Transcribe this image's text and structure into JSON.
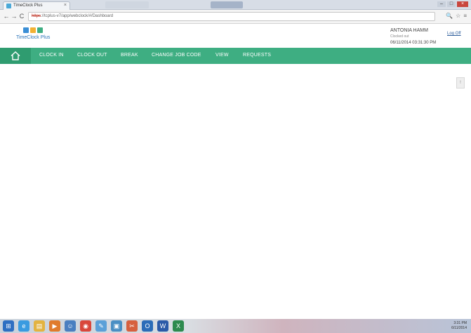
{
  "browser": {
    "tab_title": "TimeClock Plus",
    "tab_close": "×",
    "address_scheme": "https",
    "address_rest": "://tcplus-v7/app/webclock/#/Dashboard",
    "back_glyph": "←",
    "forward_glyph": "→",
    "reload_glyph": "C",
    "zoom_glyph": "🔍",
    "star_glyph": "☆",
    "menu_glyph": "≡"
  },
  "app": {
    "brand": "TimeClock Plus",
    "logo_colors": [
      "#3b8fd6",
      "#f2b134",
      "#3eae82"
    ],
    "user": {
      "name": "ANTONIA HAMM",
      "status": "Clocked out",
      "datetime": "06/11/2014  03:31:30 PM",
      "logoff_label": "Log Off"
    },
    "nav": {
      "home_icon": "home-icon",
      "items": [
        {
          "label": "CLOCK IN"
        },
        {
          "label": "CLOCK OUT"
        },
        {
          "label": "BREAK"
        },
        {
          "label": "CHANGE JOB CODE"
        },
        {
          "label": "VIEW"
        },
        {
          "label": "REQUESTS"
        }
      ]
    },
    "side_handle": "!"
  },
  "colors": {
    "nav_bg": "#3eae82",
    "nav_home_bg": "#2f9c70",
    "brand_text": "#2a73b8"
  },
  "taskbar": {
    "tray_time": "3:31 PM",
    "tray_date": "6/11/2014",
    "icons": [
      {
        "name": "start-orb-icon",
        "color": "#2e6fc2",
        "glyph": "⊞"
      },
      {
        "name": "ie-icon",
        "color": "#3a9be0",
        "glyph": "e"
      },
      {
        "name": "folder-icon",
        "color": "#e3b340",
        "glyph": "▤"
      },
      {
        "name": "media-icon",
        "color": "#e07b2c",
        "glyph": "▶"
      },
      {
        "name": "people-icon",
        "color": "#4a7fc0",
        "glyph": "☺"
      },
      {
        "name": "chrome-icon",
        "color": "#d9473b",
        "glyph": "◉"
      },
      {
        "name": "app-icon",
        "color": "#5aa0d8",
        "glyph": "✎"
      },
      {
        "name": "monitor-icon",
        "color": "#4a8fc4",
        "glyph": "▣"
      },
      {
        "name": "snip-icon",
        "color": "#d6603f",
        "glyph": "✂"
      },
      {
        "name": "outlook-icon",
        "color": "#2b6cb8",
        "glyph": "O"
      },
      {
        "name": "word-icon",
        "color": "#2b5aa8",
        "glyph": "W"
      },
      {
        "name": "excel-icon",
        "color": "#2d8a4e",
        "glyph": "X"
      }
    ]
  }
}
